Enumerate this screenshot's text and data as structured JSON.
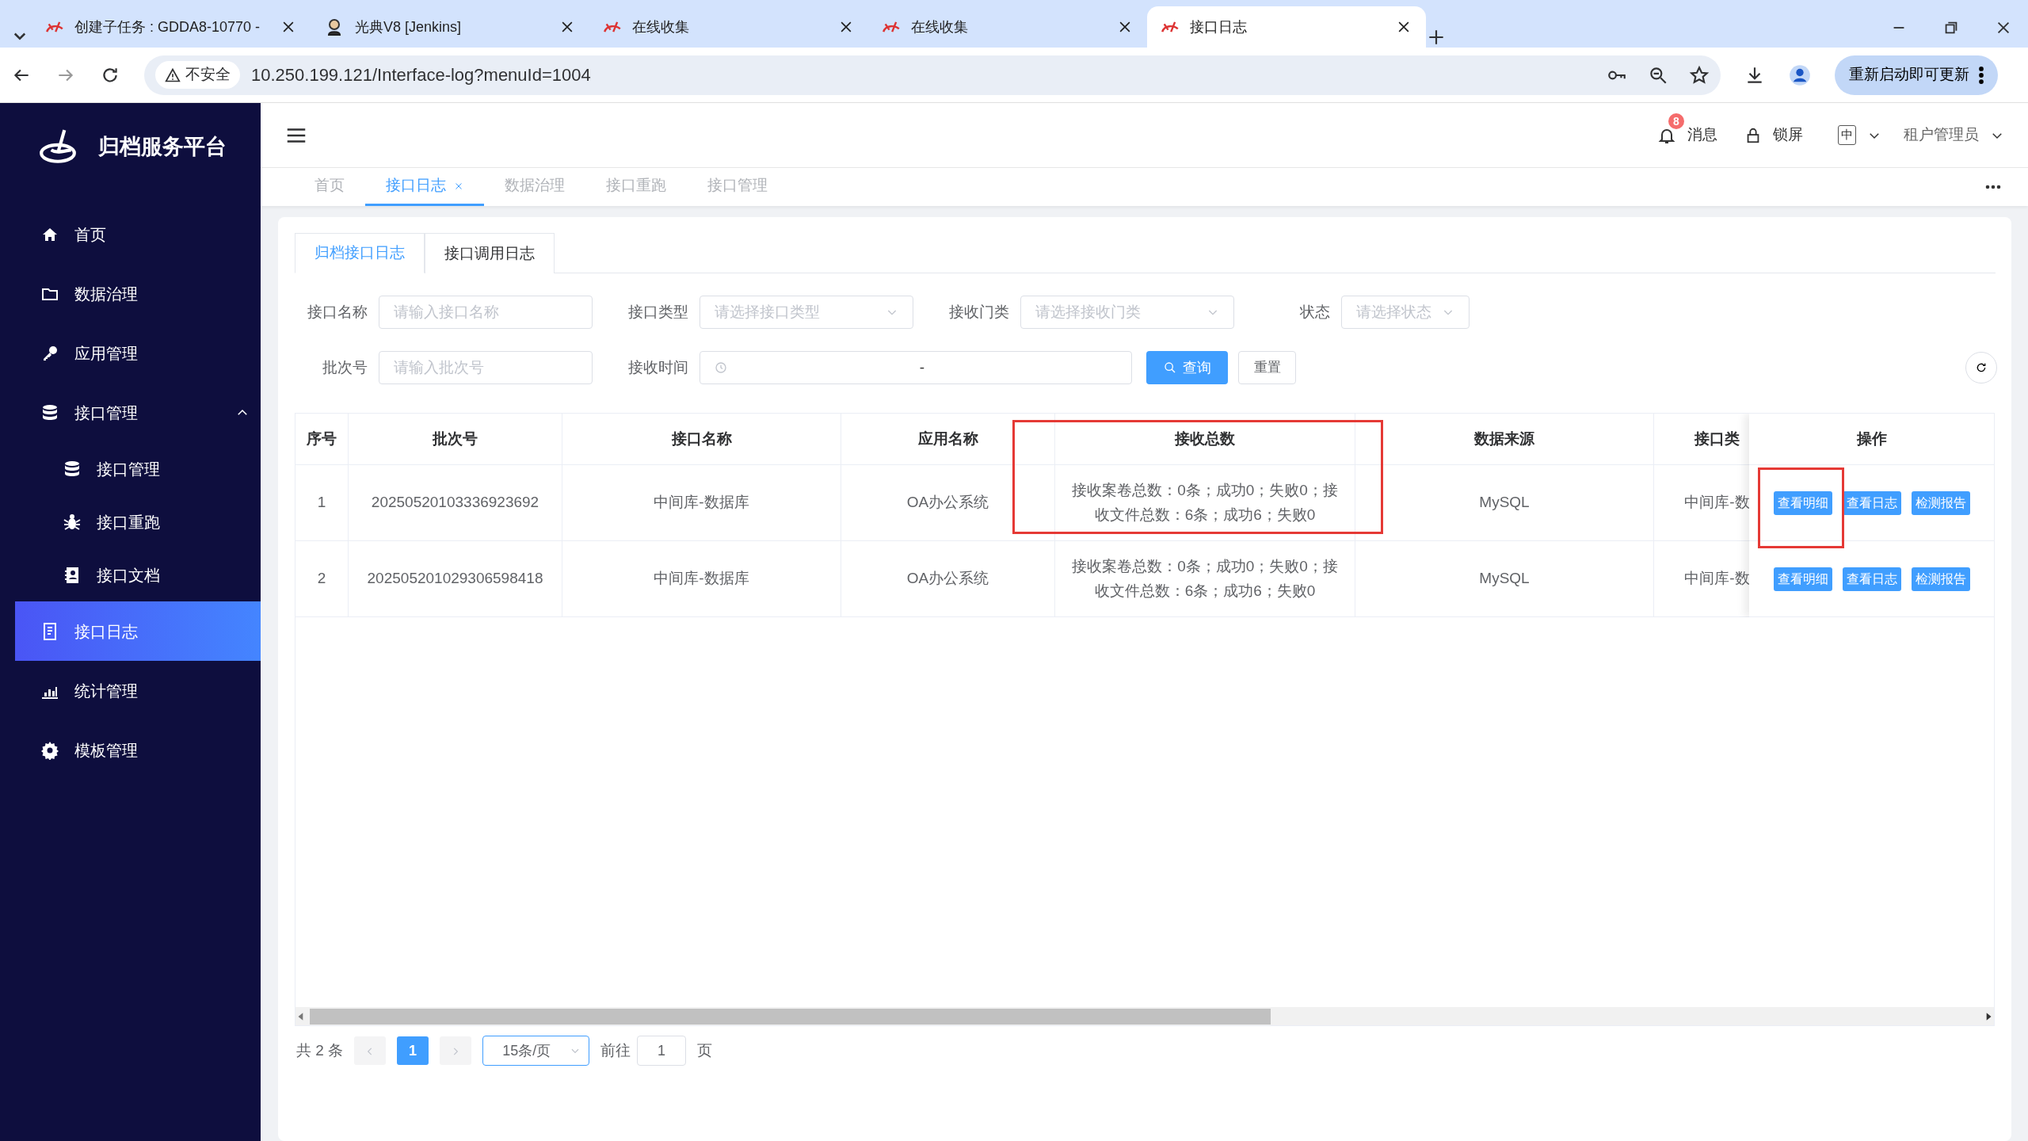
{
  "browser": {
    "tabs": [
      {
        "title": "创建子任务 : GDDA8-10770 -",
        "selected": false
      },
      {
        "title": "光典V8 [Jenkins]",
        "selected": false
      },
      {
        "title": "在线收集",
        "selected": false
      },
      {
        "title": "在线收集",
        "selected": false
      },
      {
        "title": "接口日志",
        "selected": true
      }
    ],
    "security": "不安全",
    "url": "10.250.199.121/Interface-log?menuId=1004",
    "update_button": "重新启动即可更新"
  },
  "sidebar": {
    "title": "归档服务平台",
    "items": [
      {
        "label": "首页",
        "selected": false
      },
      {
        "label": "数据治理",
        "selected": false
      },
      {
        "label": "应用管理",
        "selected": false
      },
      {
        "label": "接口管理",
        "selected": false,
        "expanded": true,
        "children": [
          {
            "label": "接口管理",
            "selected": false
          },
          {
            "label": "接口重跑",
            "selected": false
          },
          {
            "label": "接口文档",
            "selected": false
          }
        ]
      },
      {
        "label": "接口日志",
        "selected": true
      },
      {
        "label": "统计管理",
        "selected": false
      },
      {
        "label": "模板管理",
        "selected": false
      }
    ]
  },
  "header": {
    "notification_count": "8",
    "messages": "消息",
    "lock": "锁屏",
    "language": "中",
    "user": "租户管理员"
  },
  "page_tabs": [
    {
      "label": "首页",
      "selected": false,
      "closable": false
    },
    {
      "label": "接口日志",
      "selected": true,
      "closable": true
    },
    {
      "label": "数据治理",
      "selected": false,
      "closable": false
    },
    {
      "label": "接口重跑",
      "selected": false,
      "closable": false
    },
    {
      "label": "接口管理",
      "selected": false,
      "closable": false
    }
  ],
  "sub_tabs": [
    {
      "label": "归档接口日志",
      "selected": true
    },
    {
      "label": "接口调用日志",
      "selected": false
    }
  ],
  "filters": [
    [
      {
        "label": "接口名称",
        "placeholder": "请输入接口名称",
        "kind": "text"
      },
      {
        "label": "接口类型",
        "placeholder": "请选择接口类型",
        "kind": "select"
      },
      {
        "label": "接收门类",
        "placeholder": "请选择接收门类",
        "kind": "select"
      },
      {
        "label": "状态",
        "placeholder": "请选择状态",
        "kind": "select-small"
      }
    ],
    [
      {
        "label": "批次号",
        "placeholder": "请输入批次号",
        "kind": "text"
      },
      {
        "label": "接收时间",
        "separator": "-",
        "kind": "daterange"
      }
    ]
  ],
  "query_button": "查询",
  "reset_button": "重置",
  "table": {
    "columns": [
      {
        "label": "序号",
        "highlighted": false
      },
      {
        "label": "批次号",
        "highlighted": false
      },
      {
        "label": "接口名称",
        "highlighted": false
      },
      {
        "label": "应用名称",
        "highlighted": false
      },
      {
        "label": "接收总数",
        "highlighted": true
      },
      {
        "label": "数据来源",
        "highlighted": false
      },
      {
        "label": "接口类",
        "highlighted": false
      }
    ],
    "action_column": "操作",
    "rows": [
      {
        "cells": [
          "1",
          "20250520103336923692",
          "中间库-数据库",
          "OA办公系统",
          "接收案卷总数：0条；成功0；失败0；接收文件总数：6条；成功6；失败0",
          "MySQL",
          "中间库-数"
        ],
        "actions": [
          {
            "label": "查看明细",
            "highlighted": true
          },
          {
            "label": "查看日志",
            "highlighted": false
          },
          {
            "label": "检测报告",
            "highlighted": false
          }
        ]
      },
      {
        "cells": [
          "2",
          "202505201029306598418",
          "中间库-数据库",
          "OA办公系统",
          "接收案卷总数：0条；成功0；失败0；接收文件总数：6条；成功6；失败0",
          "MySQL",
          "中间库-数"
        ],
        "actions": [
          {
            "label": "查看明细",
            "highlighted": false
          },
          {
            "label": "查看日志",
            "highlighted": false
          },
          {
            "label": "检测报告",
            "highlighted": false
          }
        ]
      }
    ]
  },
  "pagination": {
    "total": "共 2 条",
    "pages": [
      {
        "label": "1",
        "selected": true
      }
    ],
    "page_size": "15条/页",
    "goto_label": "前往",
    "goto_value": "1",
    "page_suffix": "页"
  }
}
